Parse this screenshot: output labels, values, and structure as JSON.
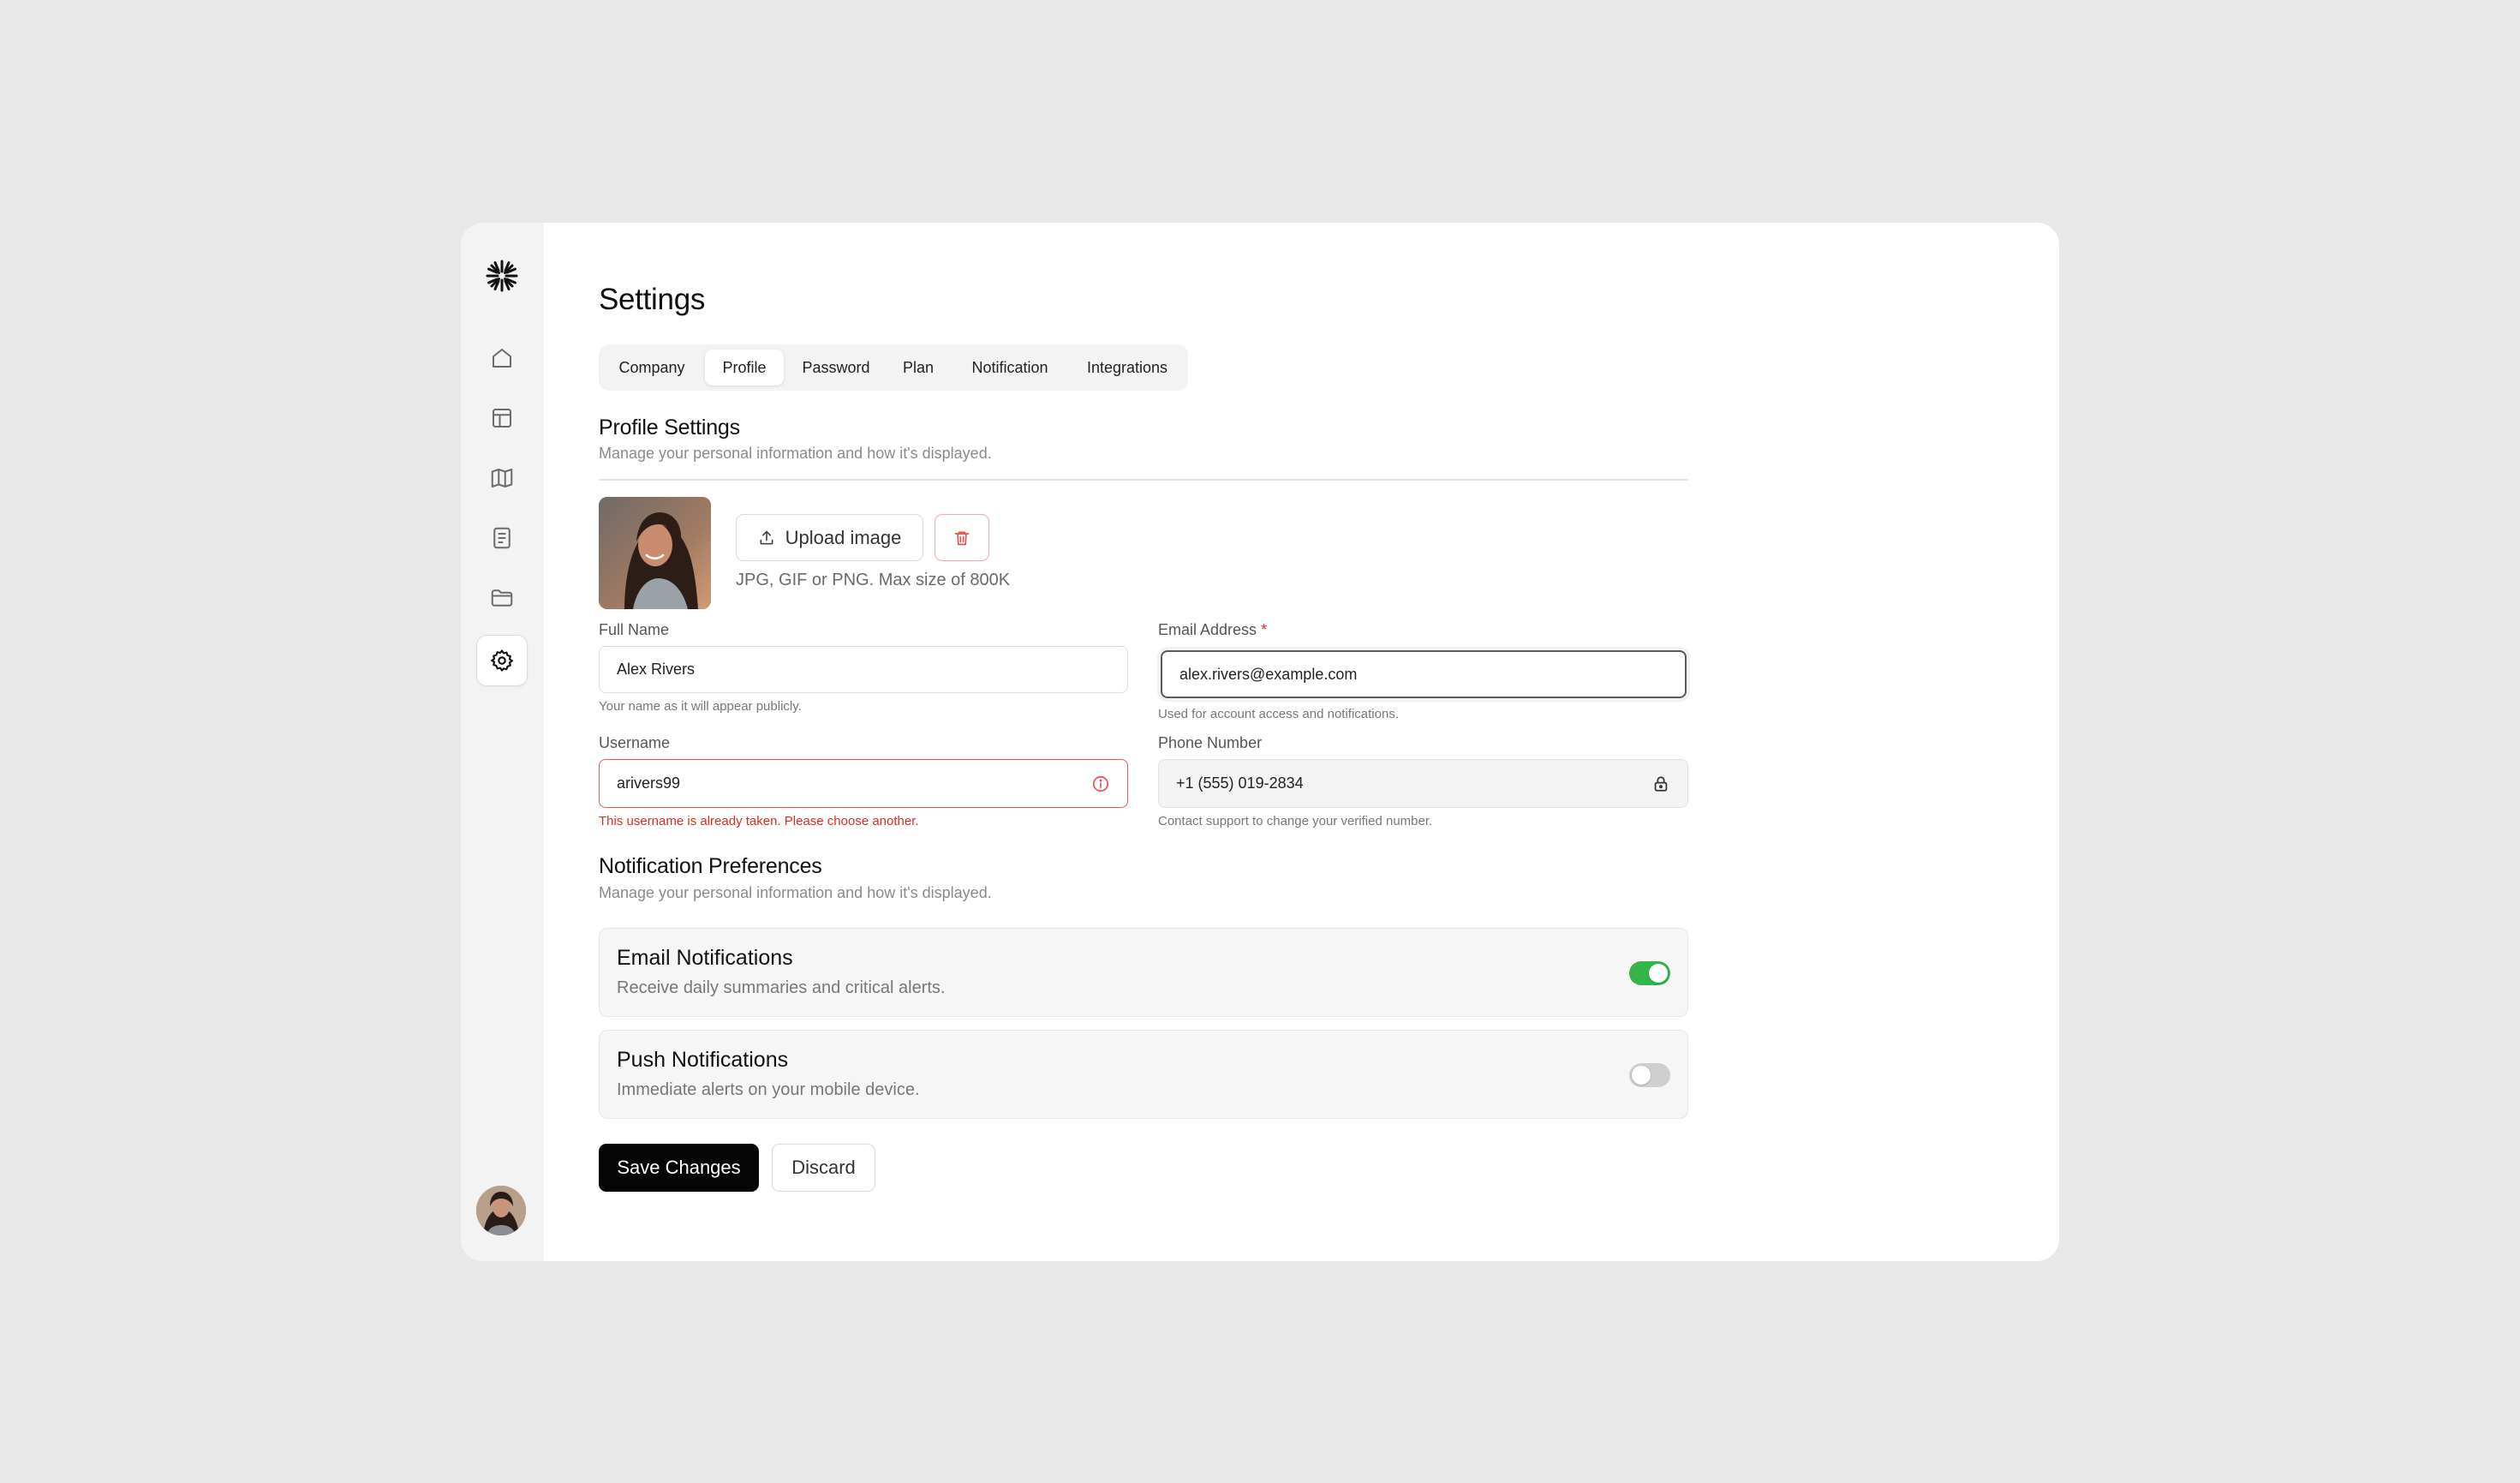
{
  "sidebar": {
    "logo_icon": "asterisk-logo-icon",
    "items": [
      {
        "name": "home",
        "icon": "home-icon",
        "active": false
      },
      {
        "name": "layout",
        "icon": "layout-icon",
        "active": false
      },
      {
        "name": "map",
        "icon": "map-icon",
        "active": false
      },
      {
        "name": "document",
        "icon": "document-icon",
        "active": false
      },
      {
        "name": "folder",
        "icon": "folder-icon",
        "active": false
      },
      {
        "name": "settings",
        "icon": "gear-icon",
        "active": true
      }
    ]
  },
  "page": {
    "title": "Settings"
  },
  "tabs": [
    {
      "label": "Company",
      "active": false
    },
    {
      "label": "Profile",
      "active": true
    },
    {
      "label": "Password",
      "active": false
    },
    {
      "label": "Plan",
      "active": false
    },
    {
      "label": "Notification",
      "active": false
    },
    {
      "label": "Integrations",
      "active": false
    }
  ],
  "profile": {
    "title": "Profile Settings",
    "subtitle": "Manage your personal information and how it's displayed.",
    "upload_label": "Upload image",
    "upload_hint": "JPG, GIF or PNG. Max size of 800K"
  },
  "fields": {
    "full_name": {
      "label": "Full Name",
      "value": "Alex Rivers",
      "help": "Your name as it will appear publicly."
    },
    "email": {
      "label": "Email Address",
      "required_mark": "*",
      "value": "alex.rivers@example.com",
      "help": "Used for account access and notifications."
    },
    "username": {
      "label": "Username",
      "value": "arivers99",
      "error": "This username is already taken. Please choose another."
    },
    "phone": {
      "label": "Phone Number",
      "value": "+1 (555) 019-2834",
      "help": "Contact support to change your verified number."
    }
  },
  "notifications": {
    "title": "Notification Preferences",
    "subtitle": "Manage your personal information and how it's displayed.",
    "items": [
      {
        "title": "Email Notifications",
        "desc": "Receive daily summaries and critical alerts.",
        "enabled": true
      },
      {
        "title": "Push Notifications",
        "desc": "Immediate alerts on your mobile device.",
        "enabled": false
      }
    ]
  },
  "actions": {
    "save_label": "Save Changes",
    "discard_label": "Discard"
  },
  "colors": {
    "accent_green": "#33b54a",
    "error_red": "#d92d20",
    "primary_button": "#050505"
  }
}
